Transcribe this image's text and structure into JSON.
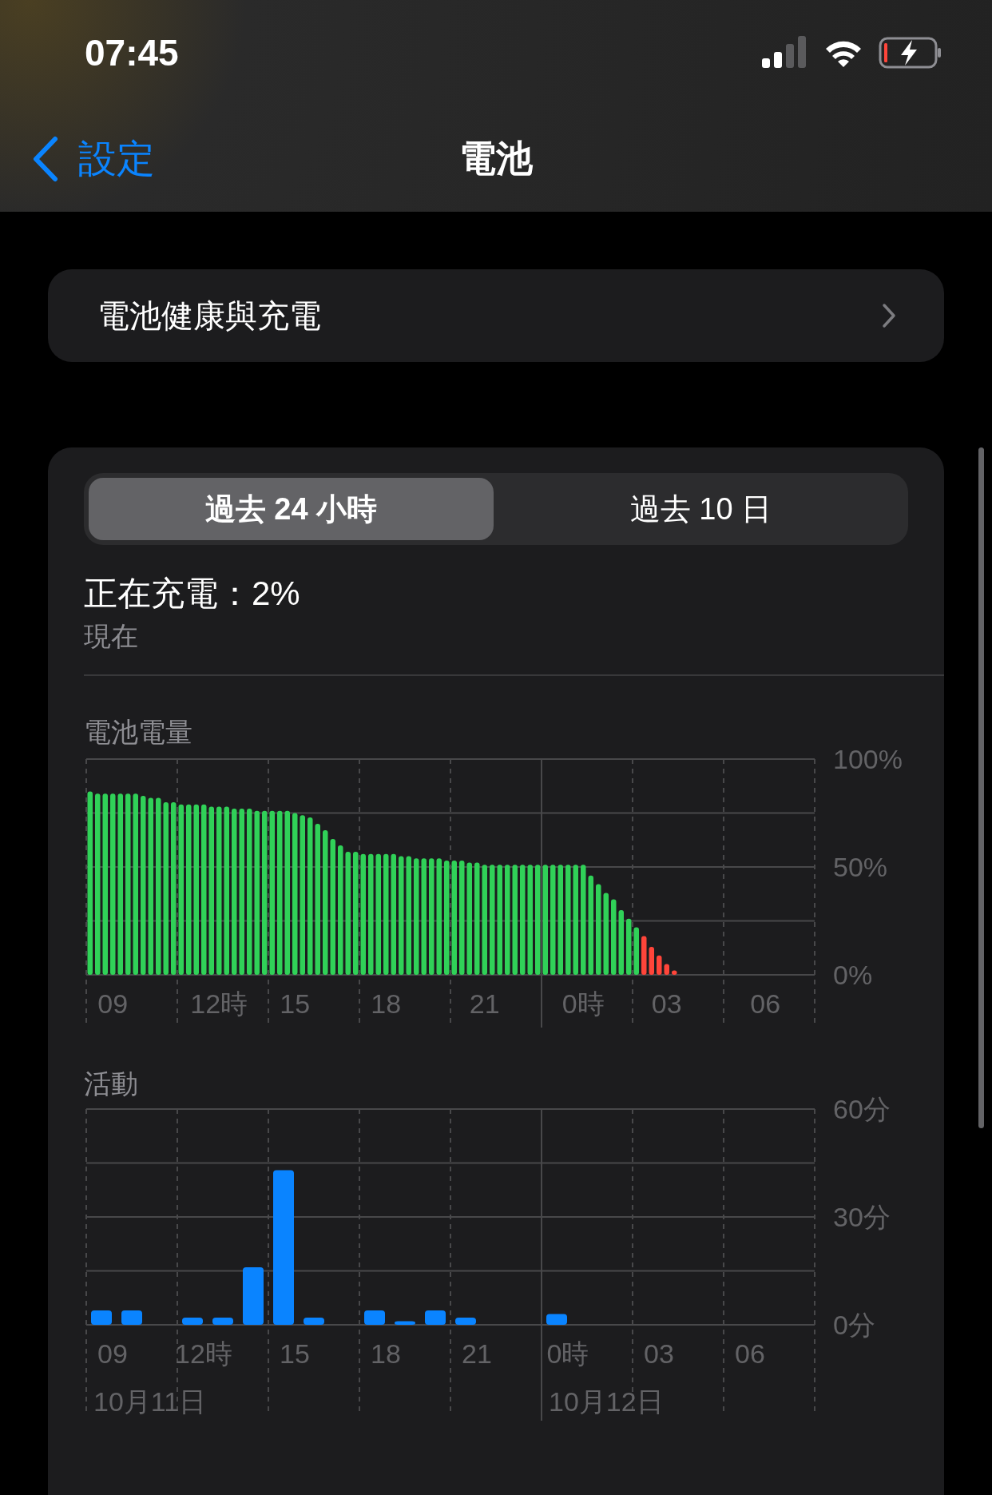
{
  "status_bar": {
    "time": "07:45"
  },
  "nav": {
    "back": "設定",
    "title": "電池"
  },
  "health_row": {
    "label": "電池健康與充電"
  },
  "segments": [
    {
      "label": "過去 24 小時",
      "selected": true
    },
    {
      "label": "過去 10 日",
      "selected": false
    }
  ],
  "charging": {
    "title": "正在充電：2%",
    "subtitle": "現在"
  },
  "battery_level": {
    "chart_data": {
      "type": "bar",
      "title": "電池電量",
      "categories": [
        null,
        null,
        null,
        "09",
        null,
        null,
        null,
        null,
        null,
        null,
        null,
        null,
        null,
        null,
        null,
        null,
        null,
        "12時",
        null,
        null,
        null,
        null,
        null,
        null,
        null,
        null,
        null,
        "15",
        null,
        null,
        null,
        null,
        null,
        null,
        null,
        null,
        null,
        null,
        null,
        "18",
        null,
        null,
        null,
        null,
        null,
        null,
        null,
        null,
        null,
        null,
        null,
        null,
        "21",
        null,
        null,
        null,
        null,
        null,
        null,
        null,
        null,
        null,
        null,
        null,
        null,
        "0時",
        null,
        null,
        null,
        null,
        null,
        null,
        null,
        null,
        null,
        null,
        "03",
        null,
        null,
        null,
        null,
        null,
        null,
        null,
        null,
        null,
        null,
        null,
        null,
        "06",
        null,
        null,
        null,
        null,
        null,
        null
      ],
      "ylim": [
        0,
        100
      ],
      "grid": true,
      "series": [
        {
          "color": "#30d158",
          "values": [
            85,
            84,
            84,
            84,
            84,
            84,
            84,
            83,
            82,
            82,
            80,
            80,
            79,
            79,
            79,
            79,
            78,
            78,
            78,
            77,
            77,
            77,
            76,
            76,
            76,
            76,
            76,
            75,
            74,
            73,
            70,
            67,
            63,
            60,
            57,
            57,
            56,
            56,
            56,
            56,
            56,
            55,
            55,
            54,
            54,
            54,
            54,
            53,
            53,
            53,
            52,
            52,
            51,
            51,
            51,
            51,
            51,
            51,
            51,
            51,
            51,
            51,
            51,
            51,
            51,
            51,
            46,
            42,
            38,
            35,
            30,
            26,
            22,
            null,
            null,
            null,
            null,
            null,
            null,
            null,
            null,
            null,
            null,
            null,
            null,
            null,
            null,
            null,
            null,
            null,
            null,
            null,
            null,
            null,
            null,
            null
          ]
        },
        {
          "color": "#ff453a",
          "values": [
            null,
            null,
            null,
            null,
            null,
            null,
            null,
            null,
            null,
            null,
            null,
            null,
            null,
            null,
            null,
            null,
            null,
            null,
            null,
            null,
            null,
            null,
            null,
            null,
            null,
            null,
            null,
            null,
            null,
            null,
            null,
            null,
            null,
            null,
            null,
            null,
            null,
            null,
            null,
            null,
            null,
            null,
            null,
            null,
            null,
            null,
            null,
            null,
            null,
            null,
            null,
            null,
            null,
            null,
            null,
            null,
            null,
            null,
            null,
            null,
            null,
            null,
            null,
            null,
            null,
            null,
            null,
            null,
            null,
            null,
            null,
            null,
            null,
            18,
            13,
            9,
            5,
            2,
            null,
            null,
            null,
            null,
            null,
            null,
            null,
            null,
            null,
            null,
            null,
            null,
            null,
            null,
            null,
            null,
            null,
            null
          ]
        }
      ],
      "yticks": [
        {
          "value": 100,
          "label": "100%"
        },
        {
          "value": 50,
          "label": "50%"
        },
        {
          "value": 0,
          "label": "0%"
        }
      ]
    }
  },
  "activity": {
    "chart_data": {
      "type": "bar",
      "title": "活動",
      "categories": [
        "09",
        null,
        null,
        "12時",
        null,
        null,
        "15",
        null,
        null,
        "18",
        null,
        null,
        "21",
        null,
        null,
        "0時",
        null,
        null,
        "03",
        null,
        null,
        "06",
        null,
        null
      ],
      "ylim": [
        0,
        60
      ],
      "grid": true,
      "series": [
        {
          "color": "#0a84ff",
          "values": [
            4,
            4,
            0,
            2,
            2,
            16,
            43,
            2,
            0,
            4,
            1,
            4,
            2,
            0,
            0,
            3,
            0,
            0,
            0,
            0,
            0,
            0,
            0,
            0
          ]
        }
      ],
      "yticks": [
        {
          "value": 60,
          "label": "60分"
        },
        {
          "value": 30,
          "label": "30分"
        },
        {
          "value": 0,
          "label": "0分"
        }
      ],
      "annotations": [
        "10月11日",
        "10月12日"
      ]
    }
  }
}
